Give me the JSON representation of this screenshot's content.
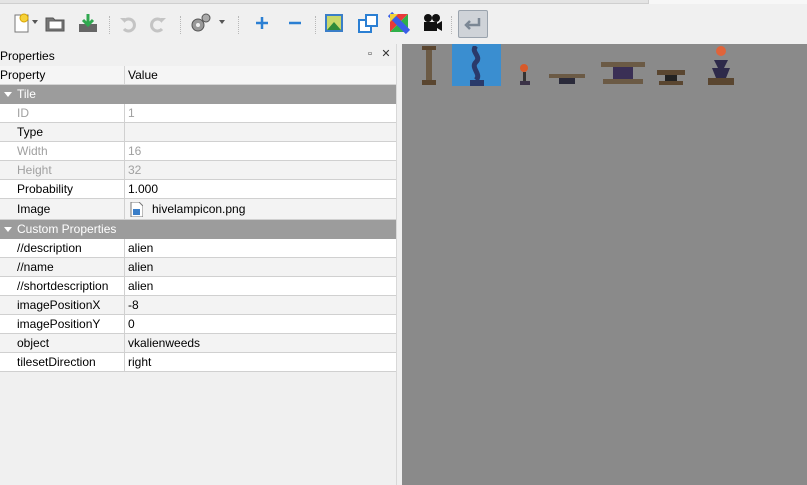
{
  "toolbar": {
    "buttons": [
      {
        "name": "new-icon"
      },
      {
        "name": "open-icon"
      },
      {
        "name": "save-icon"
      },
      {
        "name": "undo-icon"
      },
      {
        "name": "redo-icon"
      },
      {
        "name": "settings-icon"
      },
      {
        "name": "add-tile-icon"
      },
      {
        "name": "remove-tile-icon"
      },
      {
        "name": "tileset-image-icon"
      },
      {
        "name": "shape-icon"
      },
      {
        "name": "color-icon"
      },
      {
        "name": "animation-icon"
      },
      {
        "name": "return-icon"
      }
    ]
  },
  "properties": {
    "title": "Properties",
    "header": {
      "property": "Property",
      "value": "Value"
    },
    "groups": {
      "tile": "Tile",
      "custom": "Custom Properties"
    },
    "tile_rows": [
      {
        "key": "ID",
        "value": "1"
      },
      {
        "key": "Type",
        "value": ""
      },
      {
        "key": "Width",
        "value": "16"
      },
      {
        "key": "Height",
        "value": "32"
      },
      {
        "key": "Probability",
        "value": "1.000"
      },
      {
        "key": "Image",
        "value": "hivelampicon.png"
      }
    ],
    "custom_rows": [
      {
        "key": "//description",
        "value": "alien"
      },
      {
        "key": "//name",
        "value": "alien"
      },
      {
        "key": "//shortdescription",
        "value": "alien"
      },
      {
        "key": "imagePositionX",
        "value": "-8"
      },
      {
        "key": "imagePositionY",
        "value": "0"
      },
      {
        "key": "object",
        "value": "vkalienweeds"
      },
      {
        "key": "tilesetDirection",
        "value": "right"
      }
    ]
  },
  "tileset": {
    "selected_index": 1,
    "background": "#8a8a8a",
    "selection_color": "#3a8ed0"
  }
}
